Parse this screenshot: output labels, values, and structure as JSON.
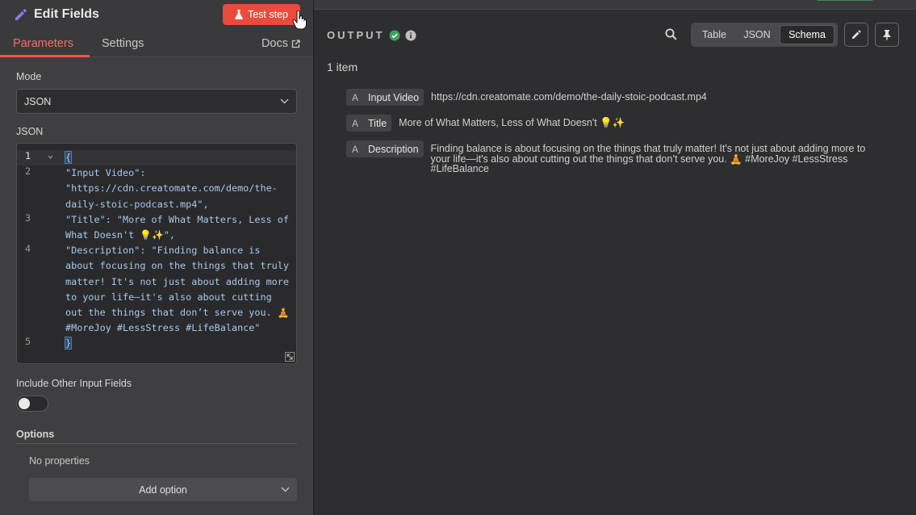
{
  "node": {
    "title": "Edit Fields",
    "test_button": "Test step",
    "tabs": [
      "Parameters",
      "Settings"
    ],
    "docs_label": "Docs"
  },
  "params": {
    "mode_label": "Mode",
    "mode_value": "JSON",
    "json_label": "JSON",
    "code_lines": [
      {
        "n": "1",
        "text": "{"
      },
      {
        "n": "2",
        "text": "\"Input Video\": \"https://cdn.creatomate.com/demo/the-daily-stoic-podcast.mp4\","
      },
      {
        "n": "3",
        "text": "\"Title\": \"More of What Matters, Less of What Doesn't 💡✨\","
      },
      {
        "n": "4",
        "text": "\"Description\": \"Finding balance is about focusing on the things that truly matter! It's not just about adding more to your life—it's also about cutting out the things that don’t serve you. 🧘 #MoreJoy #LessStress #LifeBalance\""
      },
      {
        "n": "5",
        "text": "}"
      }
    ],
    "include_label": "Include Other Input Fields",
    "include_on": false,
    "options_label": "Options",
    "no_properties": "No properties",
    "add_option": "Add option"
  },
  "output": {
    "title": "OUTPUT",
    "views": [
      "Table",
      "JSON",
      "Schema"
    ],
    "active_view": "Schema",
    "item_count": "1 item",
    "fields": [
      {
        "type": "A",
        "name": "Input Video",
        "value": "https://cdn.creatomate.com/demo/the-daily-stoic-podcast.mp4"
      },
      {
        "type": "A",
        "name": "Title",
        "value": "More of What Matters, Less of What Doesn't 💡✨"
      },
      {
        "type": "A",
        "name": "Description",
        "value": "Finding balance is about focusing on the things that truly matter! It's not just about adding more to your life—it's also about cutting out the things that don’t serve you. 🧘 #MoreJoy #LessStress #LifeBalance"
      }
    ]
  },
  "colors": {
    "accent": "#ea4b3c",
    "success": "#3aa35c",
    "code": "#a7c9ec"
  },
  "icons": [
    "pencil-icon",
    "flask-icon",
    "external-link-icon",
    "chevron-down-icon",
    "check-circle-icon",
    "info-icon",
    "search-icon",
    "edit-icon",
    "pin-icon",
    "resize-icon"
  ]
}
